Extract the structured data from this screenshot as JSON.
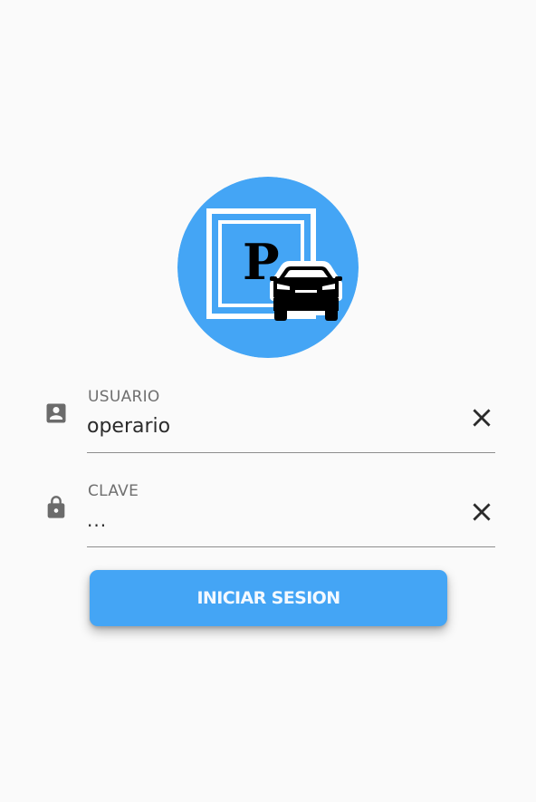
{
  "colors": {
    "accent": "#44a5f5",
    "background": "#fafafa",
    "logo_frame": "#ffffff",
    "logo_glyph": "#000000"
  },
  "logo": {
    "letter": "P",
    "icon": "parking-car-icon"
  },
  "form": {
    "username": {
      "label": "USUARIO",
      "value": "operario",
      "icon": "account-box-icon",
      "clear_icon": "close-icon"
    },
    "password": {
      "label": "CLAVE",
      "value": "...",
      "icon": "lock-icon",
      "clear_icon": "close-icon"
    },
    "submit_label": "INICIAR SESION"
  }
}
